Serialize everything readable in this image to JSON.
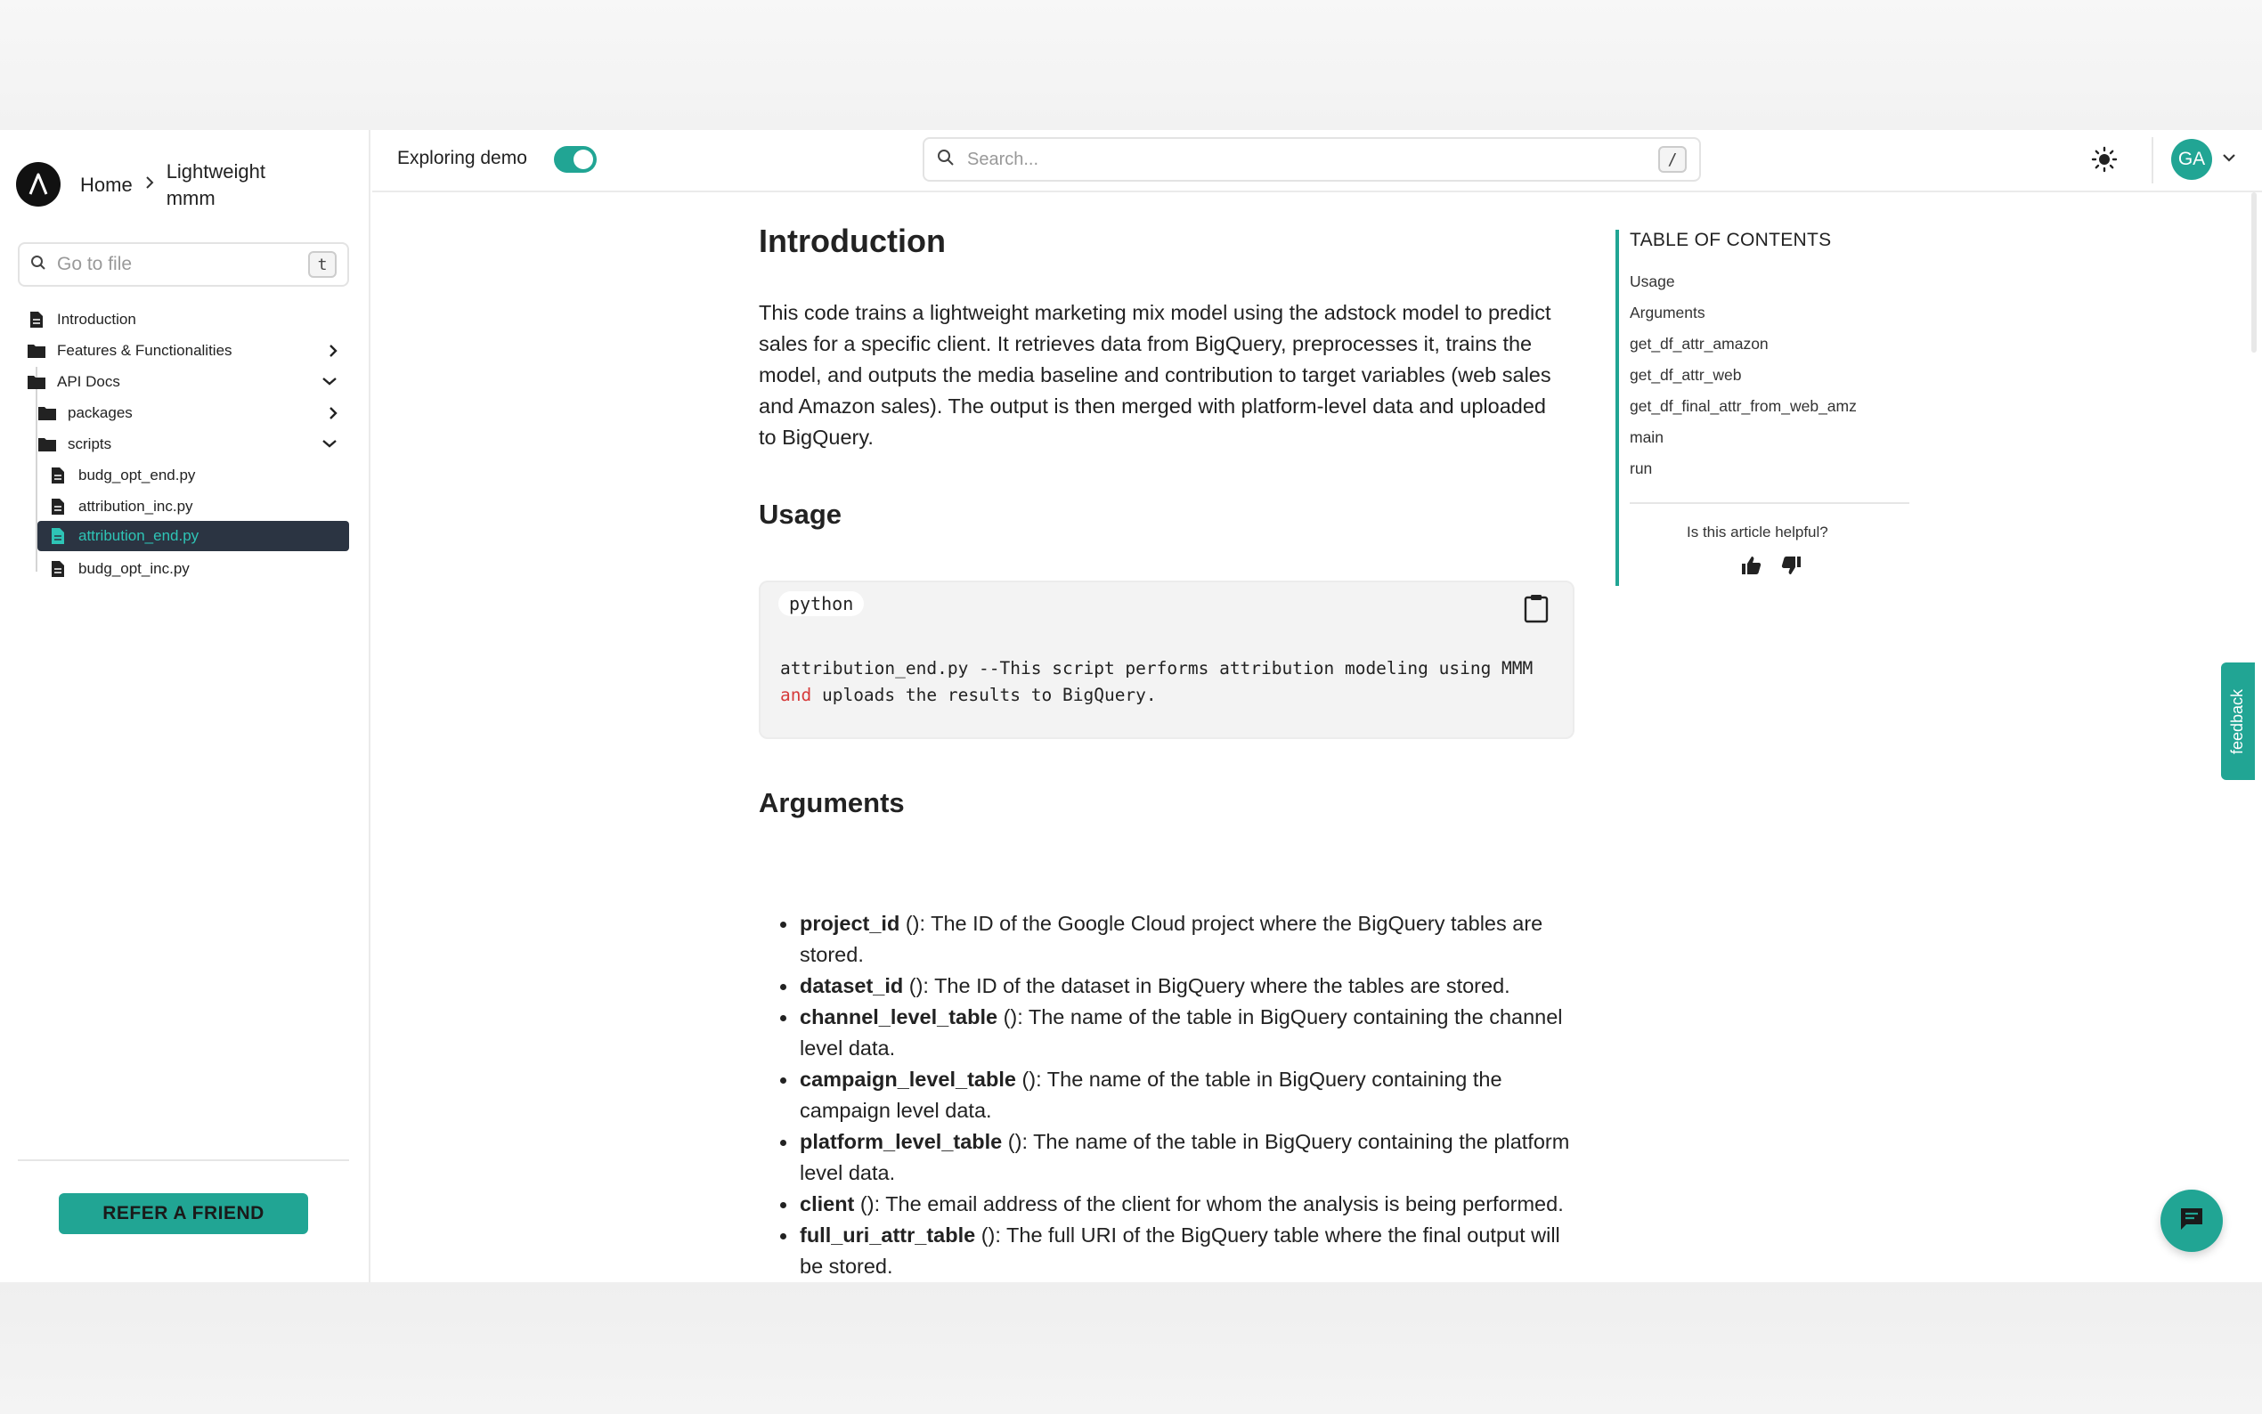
{
  "header": {
    "breadcrumb_home": "Home",
    "breadcrumb_page": "Lightweight mmm",
    "exploring_demo_label": "Exploring demo",
    "search_placeholder": "Search...",
    "search_shortcut": "/",
    "avatar_initials": "GA",
    "toggle_on": true
  },
  "sidebar": {
    "goto_placeholder": "Go to file",
    "goto_shortcut": "t",
    "items": [
      {
        "label": "Introduction",
        "type": "file"
      },
      {
        "label": "Features & Functionalities",
        "type": "folder",
        "expanded": false
      },
      {
        "label": "API Docs",
        "type": "folder",
        "expanded": true
      },
      {
        "label": "packages",
        "type": "folder",
        "expanded": false
      },
      {
        "label": "scripts",
        "type": "folder",
        "expanded": true
      },
      {
        "label": "budg_opt_end.py",
        "type": "file"
      },
      {
        "label": "attribution_inc.py",
        "type": "file"
      },
      {
        "label": "attribution_end.py",
        "type": "file",
        "active": true
      },
      {
        "label": "budg_opt_inc.py",
        "type": "file"
      }
    ],
    "refer_button": "REFER A FRIEND"
  },
  "main": {
    "title": "Introduction",
    "intro": "This code trains a lightweight marketing mix model using the adstock model to predict sales for a specific client. It retrieves data from BigQuery, preprocesses it, trains the model, and outputs the media baseline and contribution to target variables (web sales and Amazon sales). The output is then merged with platform-level data and uploaded to BigQuery.",
    "usage_heading": "Usage",
    "code_lang": "python",
    "code_part1": "attribution_end.py --This script performs attribution modeling using MMM ",
    "code_keyword": "and",
    "code_part2": " uploads the results to BigQuery.",
    "arguments_heading": "Arguments",
    "arguments": [
      {
        "name": "project_id",
        "desc": " (): The ID of the Google Cloud project where the BigQuery tables are stored."
      },
      {
        "name": "dataset_id",
        "desc": " (): The ID of the dataset in BigQuery where the tables are stored."
      },
      {
        "name": "channel_level_table",
        "desc": " (): The name of the table in BigQuery containing the channel level data."
      },
      {
        "name": "campaign_level_table",
        "desc": " (): The name of the table in BigQuery containing the campaign level data."
      },
      {
        "name": "platform_level_table",
        "desc": " (): The name of the table in BigQuery containing the platform level data."
      },
      {
        "name": "client",
        "desc": " (): The email address of the client for whom the analysis is being performed."
      },
      {
        "name": "full_uri_attr_table",
        "desc": " (): The full URI of the BigQuery table where the final output will be stored."
      }
    ]
  },
  "toc": {
    "title": "TABLE OF CONTENTS",
    "items": [
      "Usage",
      "Arguments",
      "get_df_attr_amazon",
      "get_df_attr_web",
      "get_df_final_attr_from_web_amz",
      "main",
      "run"
    ],
    "helpful_question": "Is this article helpful?"
  },
  "widgets": {
    "feedback_label": "feedback"
  },
  "icons": {
    "logo": "logo-icon",
    "breadcrumb_sep": "chevron-right-icon",
    "search": "search-icon",
    "theme": "sun-icon",
    "copy": "clipboard-icon",
    "thumbs_up": "thumbs-up-icon",
    "thumbs_down": "thumbs-down-icon",
    "chat": "chat-icon"
  },
  "colors": {
    "accent": "#21a594",
    "active_bg": "#2b3442",
    "active_text": "#2ec4b6",
    "keyword": "#d63a3a"
  }
}
